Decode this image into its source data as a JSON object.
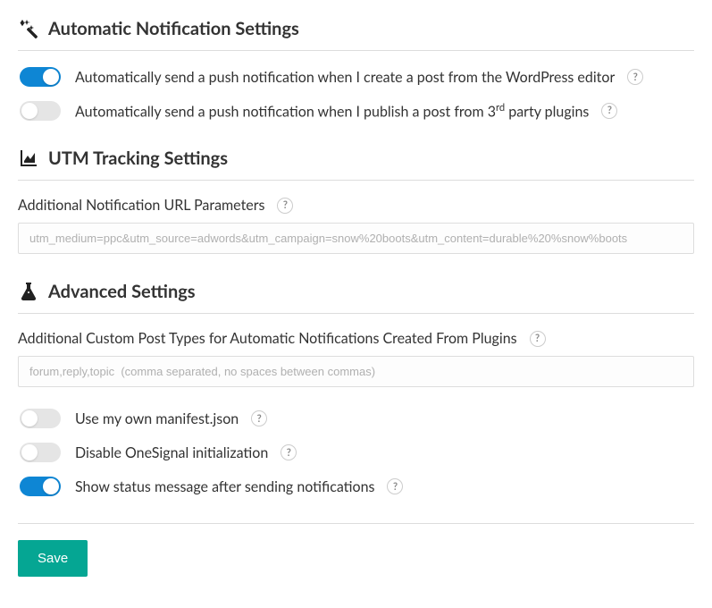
{
  "sections": {
    "auto_notif": {
      "title": "Automatic Notification Settings",
      "toggle_create": {
        "label_pre": "Automatically send a push notification when I create a post from the WordPress editor",
        "on": true
      },
      "toggle_publish": {
        "label_pre": "Automatically send a push notification when I publish a post from 3",
        "label_sup": "rd",
        "label_post": " party plugins",
        "on": false
      }
    },
    "utm": {
      "title": "UTM Tracking Settings",
      "url_params": {
        "label": "Additional Notification URL Parameters",
        "placeholder": "utm_medium=ppc&utm_source=adwords&utm_campaign=snow%20boots&utm_content=durable%20%snow%boots",
        "value": ""
      }
    },
    "advanced": {
      "title": "Advanced Settings",
      "custom_post_types": {
        "label": "Additional Custom Post Types for Automatic Notifications Created From Plugins",
        "placeholder": "forum,reply,topic  (comma separated, no spaces between commas)",
        "value": ""
      },
      "toggle_manifest": {
        "label": "Use my own manifest.json",
        "on": false
      },
      "toggle_disable_init": {
        "label": "Disable OneSignal initialization",
        "on": false
      },
      "toggle_status_msg": {
        "label": "Show status message after sending notifications",
        "on": true
      }
    }
  },
  "footer": {
    "save_label": "Save"
  },
  "help_char": "?"
}
